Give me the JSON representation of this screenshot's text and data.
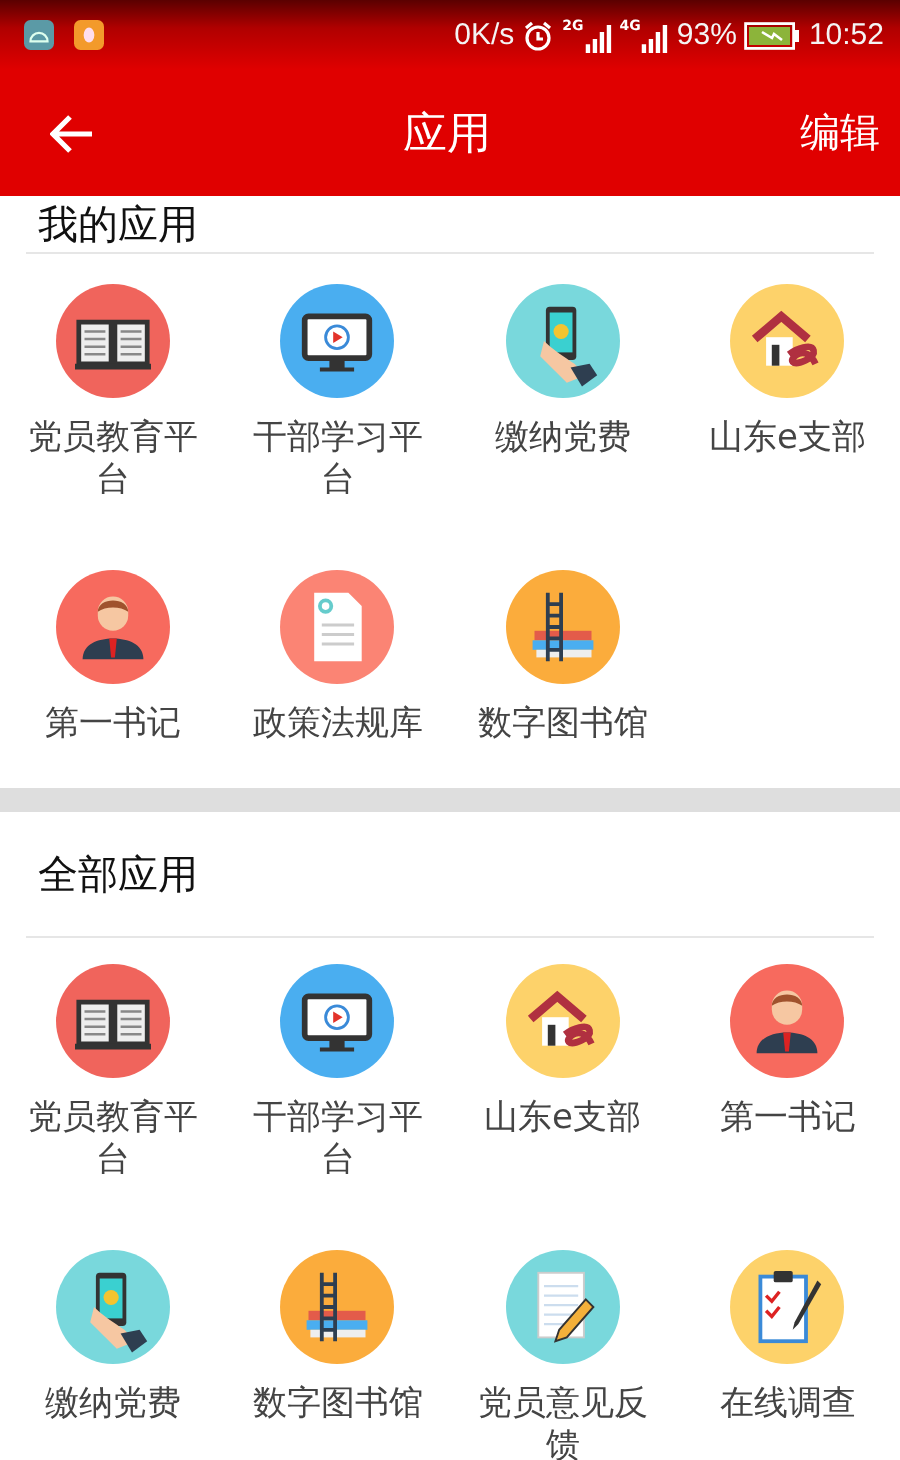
{
  "status_bar": {
    "speed": "0K/s",
    "network_1": "2G",
    "network_2": "4G",
    "battery": "93%",
    "time": "10:52"
  },
  "toolbar": {
    "title": "应用",
    "action": "编辑"
  },
  "sections": [
    {
      "title": "我的应用",
      "apps": [
        {
          "label": "党员教育平台",
          "kind": "book",
          "color": "#f0645c"
        },
        {
          "label": "干部学习平台",
          "kind": "monitor",
          "color": "#4aaef0"
        },
        {
          "label": "缴纳党费",
          "kind": "phone",
          "color": "#79d8dc"
        },
        {
          "label": "山东e支部",
          "kind": "house",
          "color": "#fdd26a"
        },
        {
          "label": "第一书记",
          "kind": "person",
          "color": "#f76a5e"
        },
        {
          "label": "政策法规库",
          "kind": "document",
          "color": "#fb8474"
        },
        {
          "label": "数字图书馆",
          "kind": "books",
          "color": "#fbac3c"
        }
      ]
    },
    {
      "title": "全部应用",
      "apps": [
        {
          "label": "党员教育平台",
          "kind": "book",
          "color": "#f0645c"
        },
        {
          "label": "干部学习平台",
          "kind": "monitor",
          "color": "#4aaef0"
        },
        {
          "label": "山东e支部",
          "kind": "house",
          "color": "#fdd26a"
        },
        {
          "label": "第一书记",
          "kind": "person",
          "color": "#f76a5e"
        },
        {
          "label": "缴纳党费",
          "kind": "phone",
          "color": "#79d8dc"
        },
        {
          "label": "数字图书馆",
          "kind": "books",
          "color": "#fbac3c"
        },
        {
          "label": "党员意见反馈",
          "kind": "notepad",
          "color": "#79d8dc"
        },
        {
          "label": "在线调查",
          "kind": "clipboard",
          "color": "#fdd26a"
        }
      ]
    }
  ]
}
